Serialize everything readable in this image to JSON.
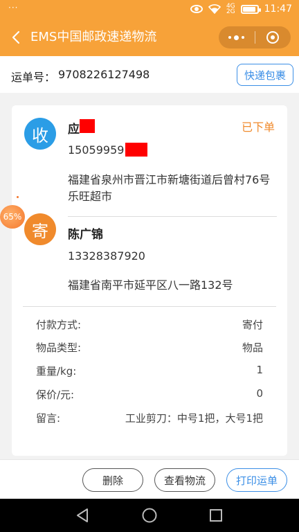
{
  "status_bar": {
    "dots": "···",
    "network": "4G",
    "network2": "2G",
    "time": "11:47",
    "battery_level": 0.8
  },
  "header": {
    "title": "EMS中国邮政速递物流"
  },
  "tracking": {
    "label": "运单号：",
    "number": "9708226127498",
    "button": "快递包裹"
  },
  "receiver": {
    "avatar": "收",
    "name": "应",
    "phone": "15059959",
    "address": "福建省泉州市晋江市新塘街道后曾村76号乐旺超市"
  },
  "order_status": "已下单",
  "sender": {
    "avatar": "寄",
    "name": "陈广锦",
    "phone": "13328387920",
    "address": "福建省南平市延平区八一路132号"
  },
  "info": [
    {
      "key": "付款方式:",
      "value": "寄付"
    },
    {
      "key": "物品类型:",
      "value": "物品"
    },
    {
      "key": "重量/kg:",
      "value": "1"
    },
    {
      "key": "保价/元:",
      "value": "0"
    },
    {
      "key": "留言:",
      "value": "工业剪刀：中号1把，大号1把"
    }
  ],
  "float_badge": "65%",
  "actions": {
    "delete": "删除",
    "view_logistics": "查看物流",
    "print": "打印运单"
  },
  "colors": {
    "primary": "#f7a239",
    "accent_blue": "#3a8ee6",
    "status_orange": "#f08a2c",
    "receiver_avatar": "#2b9de6",
    "redaction": "#ff0000"
  }
}
